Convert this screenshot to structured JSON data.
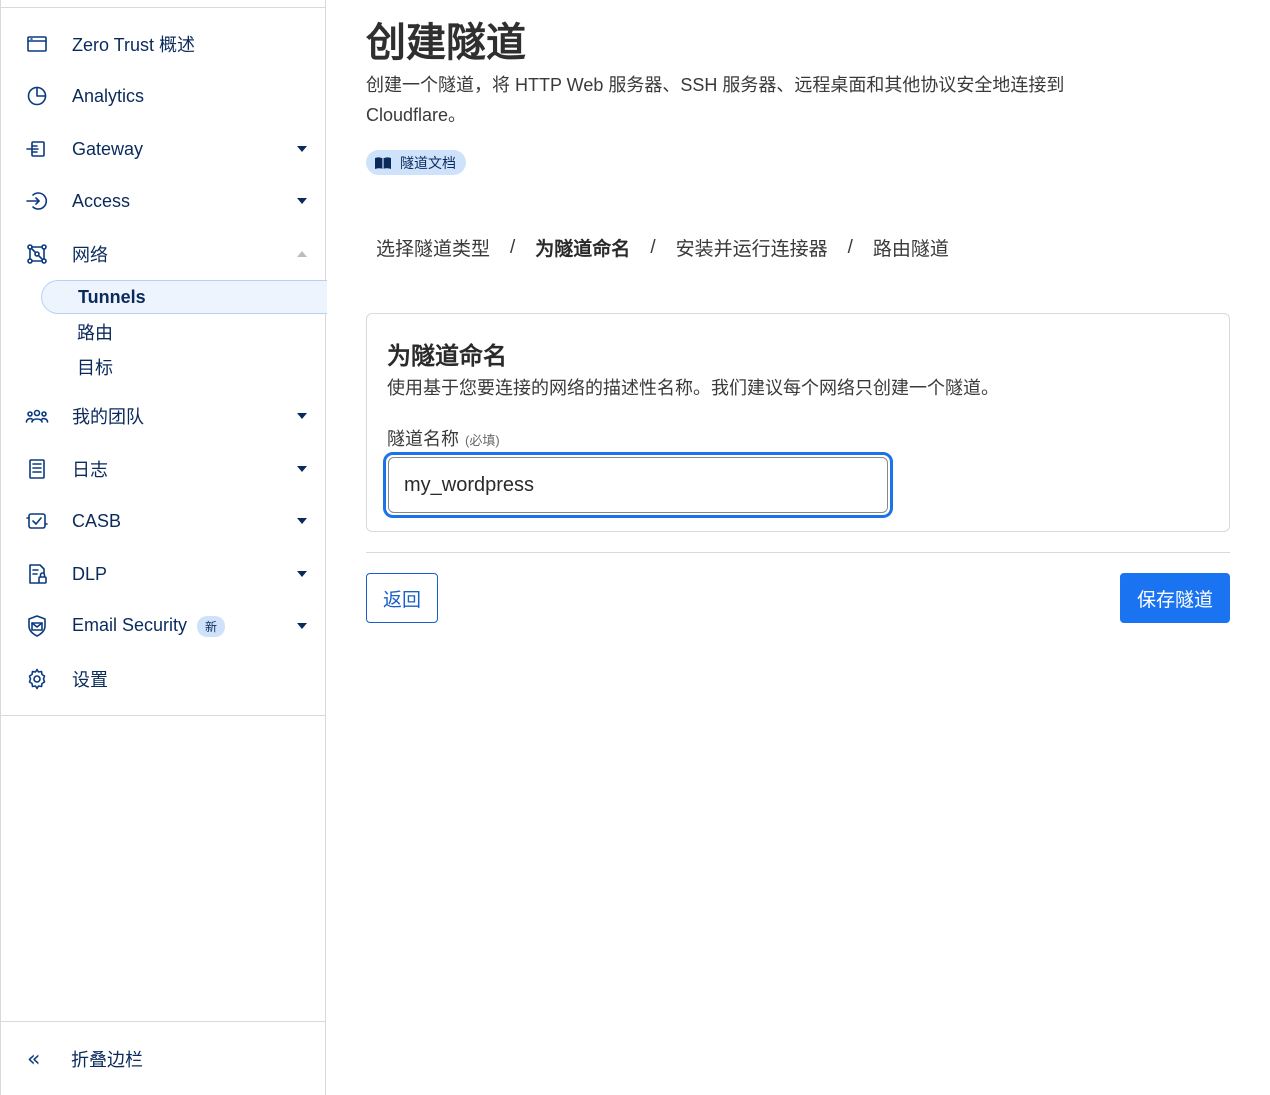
{
  "sidebar": {
    "items": [
      {
        "label": "Zero Trust 概述",
        "icon": "browser-window-icon"
      },
      {
        "label": "Analytics",
        "icon": "pie-chart-icon"
      },
      {
        "label": "Gateway",
        "icon": "gateway-icon"
      },
      {
        "label": "Access",
        "icon": "access-icon"
      },
      {
        "label": "网络",
        "icon": "network-icon"
      },
      {
        "label": "我的团队",
        "icon": "team-icon"
      },
      {
        "label": "日志",
        "icon": "logs-icon"
      },
      {
        "label": "CASB",
        "icon": "casb-icon"
      },
      {
        "label": "DLP",
        "icon": "dlp-icon"
      },
      {
        "label": "Email Security",
        "icon": "email-security-icon",
        "badge": "新"
      },
      {
        "label": "设置",
        "icon": "gear-icon"
      }
    ],
    "network_subitems": [
      {
        "label": "Tunnels",
        "active": true
      },
      {
        "label": "路由",
        "active": false
      },
      {
        "label": "目标",
        "active": false
      }
    ],
    "collapse_label": "折叠边栏"
  },
  "main": {
    "title": "创建隧道",
    "description": "创建一个隧道，将 HTTP Web 服务器、SSH 服务器、远程桌面和其他协议安全地连接到 Cloudflare。",
    "doc_link": "隧道文档",
    "steps": [
      "选择隧道类型",
      "为隧道命名",
      "安装并运行连接器",
      "路由隧道"
    ],
    "step_separator": "/",
    "card": {
      "title": "为隧道命名",
      "description": "使用基于您要连接的网络的描述性名称。我们建议每个网络只创建一个隧道。",
      "field_label": "隧道名称",
      "field_required": "(必填)",
      "field_value": "my_wordpress"
    },
    "back_label": "返回",
    "save_label": "保存隧道"
  },
  "colors": {
    "accent": "#1a73f0",
    "nav_text": "#0b2a5c",
    "badge_bg": "#cfe2fb"
  }
}
